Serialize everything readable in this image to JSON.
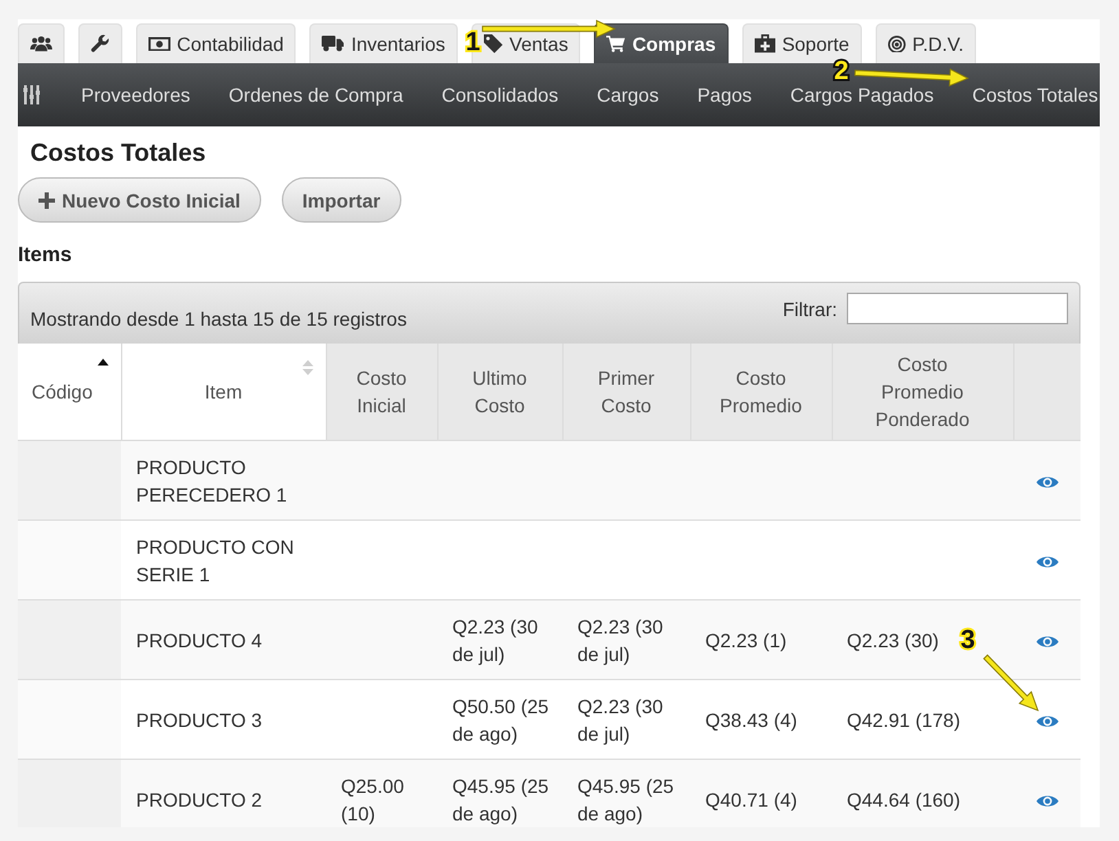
{
  "module_tabs": [
    {
      "selected": false
    },
    {
      "selected": false
    },
    {
      "label": "Contabilidad",
      "selected": false
    },
    {
      "label": "Inventarios",
      "selected": false
    },
    {
      "label": "Ventas",
      "selected": false
    },
    {
      "label": "Compras",
      "selected": true
    },
    {
      "label": "Soporte",
      "selected": false
    },
    {
      "label": "P.D.V.",
      "selected": false
    }
  ],
  "sub_nav": {
    "items": [
      {
        "label": "Proveedores"
      },
      {
        "label": "Ordenes de Compra"
      },
      {
        "label": "Consolidados"
      },
      {
        "label": "Cargos"
      },
      {
        "label": "Pagos"
      },
      {
        "label": "Cargos Pagados"
      },
      {
        "label": "Costos Totales"
      }
    ]
  },
  "page_title": "Costos Totales",
  "buttons": [
    {
      "kind": "add",
      "label": "Nuevo Costo Inicial"
    },
    {
      "kind": "plain",
      "label": "Importar"
    }
  ],
  "table": {
    "title": "Items",
    "info": "Mostrando desde 1 hasta 15 de 15 registros",
    "filter_label": "Filtrar:",
    "columns": [
      {
        "kind": "text",
        "label": "Código",
        "sortable": true,
        "sorted": true
      },
      {
        "kind": "text",
        "label": "Item",
        "sortable": true,
        "sorted": false
      },
      {
        "kind": "text",
        "label": "Costo Inicial",
        "sortable": false,
        "sorted": false
      },
      {
        "kind": "text",
        "label": "Ultimo Costo",
        "sortable": false,
        "sorted": false
      },
      {
        "kind": "text",
        "label": "Primer Costo",
        "sortable": false,
        "sorted": false
      },
      {
        "kind": "text",
        "label": "Costo Promedio",
        "sortable": false,
        "sorted": false
      },
      {
        "kind": "text",
        "label": "Costo Promedio Ponderado",
        "sortable": false,
        "sorted": false
      },
      {
        "kind": "action",
        "sortable": false,
        "sorted": false
      }
    ],
    "rows": [
      {
        "cells": [
          null,
          "PRODUCTO PERECEDERO 1",
          null,
          null,
          null,
          null,
          null
        ]
      },
      {
        "cells": [
          null,
          "PRODUCTO CON SERIE 1",
          null,
          null,
          null,
          null,
          null
        ]
      },
      {
        "cells": [
          null,
          "PRODUCTO 4",
          null,
          "Q2.23 (30 de jul)",
          "Q2.23 (30 de jul)",
          "Q2.23 (1)",
          "Q2.23 (30)"
        ]
      },
      {
        "cells": [
          null,
          "PRODUCTO 3",
          null,
          "Q50.50 (25 de ago)",
          "Q2.23 (30 de jul)",
          "Q38.43 (4)",
          "Q42.91 (178)"
        ]
      },
      {
        "cells": [
          null,
          "PRODUCTO 2",
          "Q25.00 (10)",
          "Q45.95 (25 de ago)",
          "Q45.95 (25 de ago)",
          "Q40.71 (4)",
          "Q44.64 (160)"
        ]
      }
    ]
  },
  "callouts": [
    {
      "label": "1"
    },
    {
      "label": "2"
    },
    {
      "label": "3"
    }
  ]
}
